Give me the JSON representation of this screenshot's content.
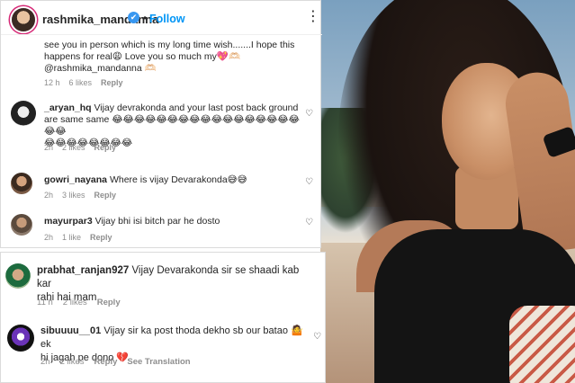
{
  "header": {
    "username": "rashmika_mandanna",
    "verified_icon": "✔",
    "separator": "•",
    "follow": "Follow",
    "more": "⋮"
  },
  "comments_top": [
    {
      "lines": [
        "see you in person which is my long time wish.......I hope this",
        "happens for real😩 Love you so much my💖🫶🏻",
        "@rashmika_mandanna 🫶🏻"
      ],
      "time": "12 h",
      "likes": "6 likes",
      "reply": "Reply"
    },
    {
      "username": "_aryan_hq",
      "lines": [
        "Vijay devrakonda and your last post back ground",
        "are same same 😂😂😂😂😂😂😂😂😂😂😂😂😂😂😂😂😂😂😂",
        "😂😂😂😂😂😂😂😂"
      ],
      "time": "2h",
      "likes": "2 likes",
      "reply": "Reply"
    },
    {
      "username": "gowri_nayana",
      "text": "Where is vijay Devarakonda😅😅",
      "time": "2h",
      "likes": "3 likes",
      "reply": "Reply"
    },
    {
      "username": "mayurpar3",
      "text": "Vijay bhi isi bitch par he dosto",
      "time": "2h",
      "likes": "1 like",
      "reply": "Reply"
    }
  ],
  "comments_bottom": [
    {
      "username": "prabhat_ranjan927",
      "line1": "Vijay Devarakonda sir se shaadi kab kar",
      "line2": "rahi hai mam",
      "time": "11 h",
      "likes": "2 likes",
      "reply": "Reply"
    },
    {
      "username": "sibuuuu__01",
      "line1": "Vijay sir ka post thoda dekho sb our batao 🤷 ek",
      "line2": "hi jagah pe dono 💔",
      "time": "2h",
      "likes": "2 likes",
      "reply": "Reply",
      "translation": "See Translation"
    }
  ],
  "heart_icon": "♡",
  "colors": {
    "accent": "#0095f6",
    "meta": "#8e8e8e",
    "verified": "#3897f0"
  }
}
